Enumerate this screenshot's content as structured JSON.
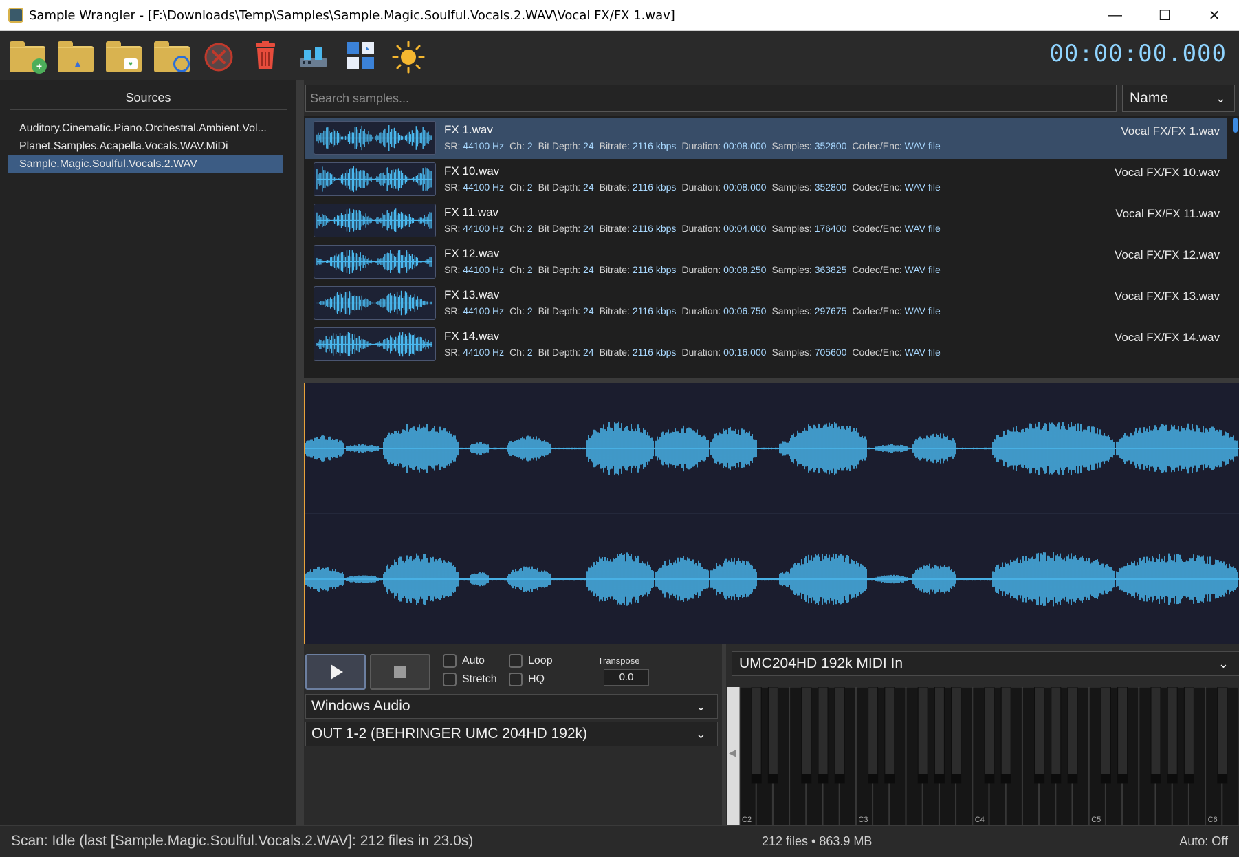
{
  "window": {
    "title": "Sample Wrangler - [F:\\Downloads\\Temp\\Samples\\Sample.Magic.Soulful.Vocals.2.WAV\\Vocal FX/FX 1.wav]",
    "minimize": "—",
    "maximize": "☐",
    "close": "✕"
  },
  "toolbar": {
    "icons": [
      "add-folder-icon",
      "launch-folder-icon",
      "image-folder-icon",
      "rescan-folder-icon",
      "cancel-icon",
      "trash-icon",
      "devices-icon",
      "layout-icon",
      "theme-sun-icon"
    ],
    "timer": "00:00:00.000"
  },
  "sources": {
    "title": "Sources",
    "items": [
      "Auditory.Cinematic.Piano.Orchestral.Ambient.Vol...",
      "Planet.Samples.Acapella.Vocals.WAV.MiDi",
      "Sample.Magic.Soulful.Vocals.2.WAV"
    ],
    "selected_index": 2
  },
  "search": {
    "placeholder": "Search samples..."
  },
  "sort": {
    "label": "Name"
  },
  "meta_labels": {
    "sr": "SR:",
    "ch": "Ch:",
    "bit": "Bit Depth:",
    "bitrate": "Bitrate:",
    "duration": "Duration:",
    "samples": "Samples:",
    "codec": "Codec/Enc:"
  },
  "samples": [
    {
      "name": "FX 1.wav",
      "sr": "44100 Hz",
      "ch": "2",
      "bit": "24",
      "bitrate": "2116 kbps",
      "duration": "00:08.000",
      "samples": "352800",
      "codec": "WAV file",
      "path": "Vocal FX/FX 1.wav"
    },
    {
      "name": "FX 10.wav",
      "sr": "44100 Hz",
      "ch": "2",
      "bit": "24",
      "bitrate": "2116 kbps",
      "duration": "00:08.000",
      "samples": "352800",
      "codec": "WAV file",
      "path": "Vocal FX/FX 10.wav"
    },
    {
      "name": "FX 11.wav",
      "sr": "44100 Hz",
      "ch": "2",
      "bit": "24",
      "bitrate": "2116 kbps",
      "duration": "00:04.000",
      "samples": "176400",
      "codec": "WAV file",
      "path": "Vocal FX/FX 11.wav"
    },
    {
      "name": "FX 12.wav",
      "sr": "44100 Hz",
      "ch": "2",
      "bit": "24",
      "bitrate": "2116 kbps",
      "duration": "00:08.250",
      "samples": "363825",
      "codec": "WAV file",
      "path": "Vocal FX/FX 12.wav"
    },
    {
      "name": "FX 13.wav",
      "sr": "44100 Hz",
      "ch": "2",
      "bit": "24",
      "bitrate": "2116 kbps",
      "duration": "00:06.750",
      "samples": "297675",
      "codec": "WAV file",
      "path": "Vocal FX/FX 13.wav"
    },
    {
      "name": "FX 14.wav",
      "sr": "44100 Hz",
      "ch": "2",
      "bit": "24",
      "bitrate": "2116 kbps",
      "duration": "00:16.000",
      "samples": "705600",
      "codec": "WAV file",
      "path": "Vocal FX/FX 14.wav"
    }
  ],
  "transport": {
    "auto": "Auto",
    "stretch": "Stretch",
    "loop": "Loop",
    "hq": "HQ",
    "transpose_label": "Transpose",
    "transpose_value": "0.0",
    "audio_driver": "Windows Audio",
    "audio_output": "OUT 1-2 (BEHRINGER UMC 204HD 192k)"
  },
  "keyboard": {
    "midi_input": "UMC204HD 192k MIDI In",
    "octave_labels": [
      "C2",
      "C3",
      "C4",
      "C5",
      "C6"
    ],
    "scroll_left": "◀"
  },
  "status": {
    "scan": "Scan: Idle (last [Sample.Magic.Soulful.Vocals.2.WAV]: 212 files in 23.0s)",
    "summary": "212 files • 863.9 MB",
    "auto": "Auto: Off"
  },
  "colors": {
    "waveform": "#4ab8ee",
    "waveform_bg": "#1b1d2e",
    "selection": "#384d68",
    "accent": "#8fd4ff",
    "playhead": "#e8a23a"
  }
}
